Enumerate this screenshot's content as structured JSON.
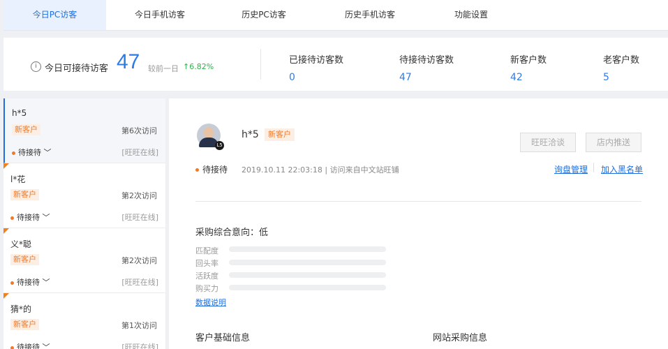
{
  "tabs": [
    {
      "label": "今日PC访客",
      "active": true
    },
    {
      "label": "今日手机访客",
      "active": false
    },
    {
      "label": "历史PC访客",
      "active": false
    },
    {
      "label": "历史手机访客",
      "active": false
    },
    {
      "label": "功能设置",
      "active": false
    }
  ],
  "stats": {
    "today_label": "今日可接待访客",
    "today_count": "47",
    "compare_label": "较前一日",
    "trend": "6.82%",
    "items": [
      {
        "label": "已接待访客数",
        "value": "0"
      },
      {
        "label": "待接待访客数",
        "value": "47"
      },
      {
        "label": "新客户数",
        "value": "42"
      },
      {
        "label": "老客户数",
        "value": "5"
      }
    ]
  },
  "visitors": [
    {
      "name": "h*5",
      "tag": "新客户",
      "visits": "第6次访问",
      "status": "待接待",
      "online": "[旺旺在线]"
    },
    {
      "name": "l*花",
      "tag": "新客户",
      "visits": "第2次访问",
      "status": "待接待",
      "online": "[旺旺在线]"
    },
    {
      "name": "义*聪",
      "tag": "新客户",
      "visits": "第2次访问",
      "status": "待接待",
      "online": "[旺旺在线]"
    },
    {
      "name": "猜*的",
      "tag": "新客户",
      "visits": "第1次访问",
      "status": "待接待",
      "online": "[旺旺在线]"
    }
  ],
  "detail": {
    "name": "h*5",
    "tag": "新客户",
    "level": "L5",
    "buttons": {
      "chat": "旺旺洽谈",
      "push": "店内推送"
    },
    "status": "待接待",
    "visit_info": "2019.10.11 22:03:18 | 访问来自中文站旺铺",
    "links": {
      "inquiry": "询盘管理",
      "blacklist": "加入黑名单"
    },
    "intent_label": "采购综合意向：低",
    "metrics": [
      {
        "label": "匹配度",
        "value": 0
      },
      {
        "label": "回头率",
        "value": 0
      },
      {
        "label": "活跃度",
        "value": 0
      },
      {
        "label": "购买力",
        "value": 0
      }
    ],
    "data_link": "数据说明",
    "sections": {
      "basic": "客户基础信息",
      "purchase": "网站采购信息"
    }
  },
  "colors": {
    "accent": "#1f6fe0",
    "orange": "#f07a2a",
    "green": "#2fb24c"
  }
}
